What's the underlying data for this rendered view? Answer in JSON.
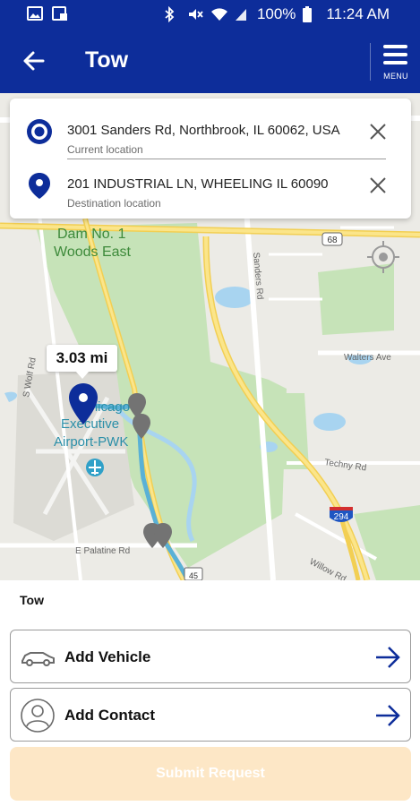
{
  "status_bar": {
    "battery": "100%",
    "time": "11:24 AM",
    "icons": [
      "image-icon",
      "screenshot-icon",
      "bluetooth-icon",
      "mute-icon",
      "wifi-icon",
      "signal-icon",
      "battery-icon"
    ]
  },
  "header": {
    "title": "Tow",
    "menu_label": "MENU",
    "bg_color": "#0d2d9a"
  },
  "route": {
    "current_address": "3001 Sanders Rd, Northbrook, IL 60062, USA",
    "current_caption": "Current location",
    "destination_address": "201 INDUSTRIAL LN, WHEELING IL 60090",
    "destination_caption": "Destination location"
  },
  "map": {
    "distance": "3.03 mi",
    "labels": {
      "dam": "Dam No. 1",
      "woods": "Woods East",
      "airport1": "Chicago",
      "airport2": "Executive",
      "airport3": "Airport-PWK",
      "wolf": "S Wolf Rd",
      "sanders": "Sanders Rd",
      "walters": "Walters Ave",
      "techny": "Techny Rd",
      "palatine": "E Palatine Rd",
      "willow": "Willow Rd",
      "shield68": "68",
      "shield294": "294",
      "shield45": "45"
    },
    "route_color": "#5ab1d6",
    "pin_color": "#0d2d9a"
  },
  "service": {
    "section_label": "Tow",
    "add_vehicle": "Add Vehicle",
    "add_contact": "Add Contact",
    "submit": "Submit Request"
  }
}
